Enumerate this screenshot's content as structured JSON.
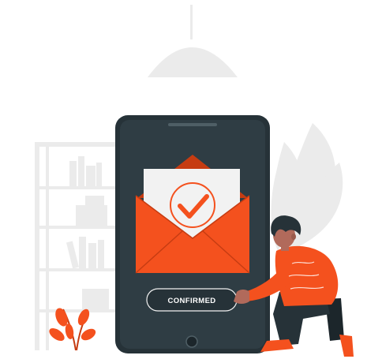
{
  "illustration": {
    "button_label": "CONFIRMED"
  },
  "colors": {
    "accent": "#f4511e",
    "accent_dark": "#c63c12",
    "phone_body": "#263238",
    "phone_edge": "#37474f",
    "paper": "#f2f2f2",
    "decor_gray": "#ebebeb",
    "skin": "#b16a5b",
    "hair": "#263238",
    "pants": "#263238"
  },
  "icons": {
    "envelope": "envelope-icon",
    "check": "check-circle-icon",
    "lamp": "ceiling-lamp-icon"
  }
}
